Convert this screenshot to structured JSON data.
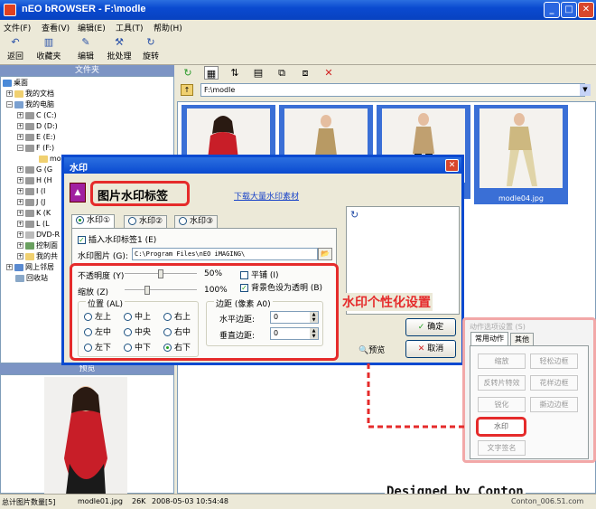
{
  "window": {
    "title": "nEO bROWSER - F:\\modle"
  },
  "menu": [
    "文件(F)",
    "查看(V)",
    "编辑(E)",
    "工具(T)",
    "帮助(H)"
  ],
  "toolbar": [
    "返回",
    "收藏夹",
    "编辑",
    "批处理",
    "旋转"
  ],
  "left": {
    "folder_header": "文件夹",
    "preview_header": "预览",
    "tree": [
      "桌面",
      "我的文档",
      "我的电脑",
      "C (C:)",
      "D (D:)",
      "E (E:)",
      "F (F:)",
      "mo",
      "G (G",
      "H (H",
      "I (I",
      "J (J",
      "K (K",
      "L (L",
      "DVD-R",
      "控制面",
      "我的共",
      "网上邻居",
      "回收站"
    ]
  },
  "address": "F:\\modle",
  "thumbnails": [
    "",
    "",
    "",
    "modle04.jpg"
  ],
  "dialog": {
    "title": "水印",
    "heading": "图片水印标签",
    "link": "下载大量水印素材",
    "tabs": [
      "水印①",
      "水印②",
      "水印③"
    ],
    "insert_label": "插入水印标签1 (E)",
    "image_label": "水印图片 (G):",
    "image_path": "C:\\Program Files\\nEO iMAGING\\",
    "opacity_label": "不透明度 (Y)",
    "opacity_pct": "50%",
    "opacity_value": 0.5,
    "scale_label": "缩放 (Z)",
    "scale_pct": "100%",
    "scale_value": 0.3,
    "tile_label": "平铺 (I)",
    "transparent_label": "背景色设为透明 (B)",
    "position_label": "位置 (AL)",
    "positions": [
      "左上",
      "中上",
      "右上",
      "左中",
      "中央",
      "右中",
      "左下",
      "中下",
      "右下"
    ],
    "margin_label": "边距 (像素 A0)",
    "h_margin_label": "水平边距:",
    "h_margin_value": "0",
    "v_margin_label": "垂直边距:",
    "v_margin_value": "0",
    "ok_label": "确定",
    "preview_label": "预览",
    "cancel_label": "取消",
    "annotation": "水印个性化设置"
  },
  "action_panel": {
    "title": "动作选项设置 (S)",
    "tabs": [
      "常用动作",
      "其他"
    ],
    "buttons": [
      "缩放",
      "轻松边框",
      "反转片特效",
      "花样边框",
      "锐化",
      "撕边边框",
      "水印",
      "文字签名"
    ]
  },
  "status": {
    "count": "总计图片数量[5]",
    "file": "modle01.jpg",
    "size": "26K",
    "date": "2008-05-03 10:54:48"
  },
  "credit": "Designed by Conton",
  "watermark_text": "Conton_006.51.com",
  "colors": {
    "highlight": "#e52b2b",
    "title_bar": "#0a4ad0",
    "selection": "#3a6fd6"
  }
}
